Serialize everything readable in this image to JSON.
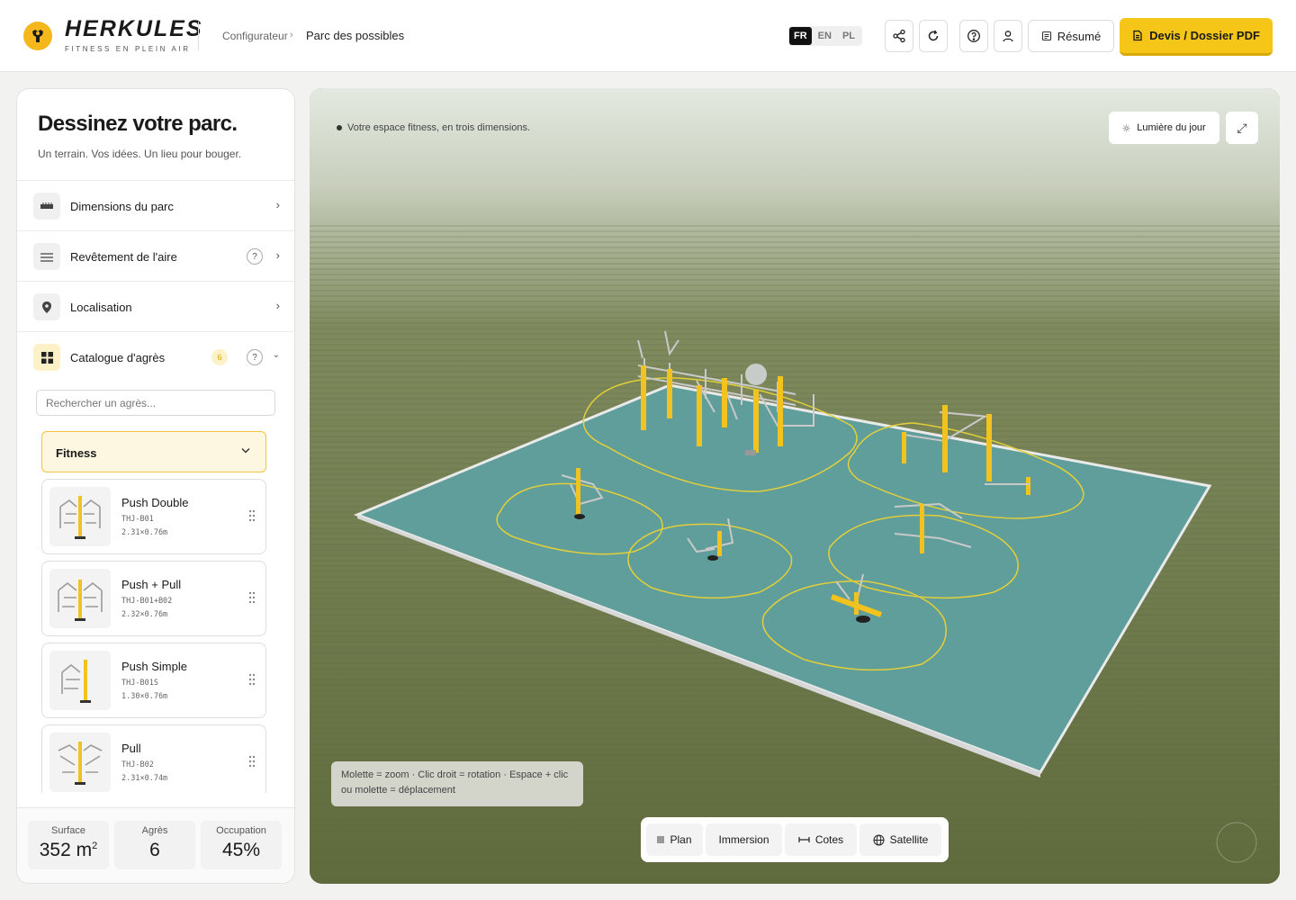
{
  "brand": {
    "name": "HERKULES",
    "tagline": "FITNESS EN PLEIN AIR"
  },
  "breadcrumb": {
    "parent": "Configurateur",
    "current": "Parc des possibles"
  },
  "languages": [
    {
      "code": "FR",
      "active": true
    },
    {
      "code": "EN",
      "active": false
    },
    {
      "code": "PL",
      "active": false
    }
  ],
  "header_actions": {
    "icons": [
      "share-icon",
      "refresh-icon",
      "help-icon",
      "user-icon"
    ],
    "resume_label": "Résumé",
    "pdf_label": "Devis / Dossier PDF"
  },
  "sidebar": {
    "title": "Dessinez votre parc.",
    "subtitle": "Un terrain. Vos idées. Un lieu pour bouger.",
    "sections": [
      {
        "label": "Dimensions du parc",
        "icon": "ruler-icon"
      },
      {
        "label": "Revêtement de l'aire",
        "icon": "layers-icon",
        "help": "?"
      },
      {
        "label": "Localisation",
        "icon": "location-pin-icon"
      },
      {
        "label": "Catalogue d'agrès",
        "icon": "grid-icon",
        "badge": "6",
        "help": "?"
      }
    ],
    "search_placeholder": "Rechercher un agrès...",
    "category": "Fitness",
    "items": [
      {
        "name": "Push Double",
        "ref": "THJ-B01",
        "dims": "2.31×0.76m"
      },
      {
        "name": "Push + Pull",
        "ref": "THJ-B01+B02",
        "dims": "2.32×0.76m"
      },
      {
        "name": "Push Simple",
        "ref": "THJ-B01S",
        "dims": "1.30×0.76m"
      },
      {
        "name": "Pull",
        "ref": "THJ-B02",
        "dims": "2.31×0.74m"
      }
    ],
    "stats": {
      "surface_label": "Surface",
      "surface_value": "352 m",
      "surface_unit": "2",
      "equipment_label": "Agrès",
      "equipment_value": "6",
      "occupancy_label": "Occupation",
      "occupancy_value": "45%"
    }
  },
  "viewport": {
    "caption": "Votre espace fitness, en trois dimensions.",
    "light_label": "Lumière du jour",
    "hint": "Molette = zoom · Clic droit = rotation · Espace + clic ou molette = déplacement",
    "modes": [
      {
        "label": "Plan",
        "icon": "square-icon"
      },
      {
        "label": "Immersion",
        "icon": ""
      },
      {
        "label": "Cotes",
        "icon": "measure-icon"
      },
      {
        "label": "Satellite",
        "icon": "globe-icon"
      }
    ]
  },
  "colors": {
    "accent": "#f5c518",
    "surface": "#5f9e9a",
    "grass": "#6b7649",
    "markings": "#e3cf3a"
  }
}
